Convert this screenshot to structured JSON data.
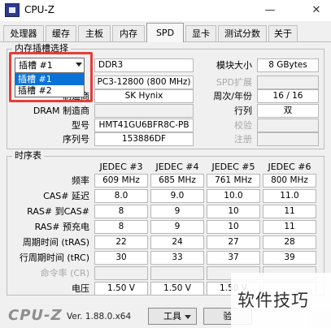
{
  "window": {
    "title": "CPU-Z",
    "minimize_glyph": "—",
    "close_glyph": "✕"
  },
  "tabs": [
    "处理器",
    "缓存",
    "主板",
    "内存",
    "SPD",
    "显卡",
    "测试分数",
    "关于"
  ],
  "slot": {
    "legend": "内存插槽选择",
    "selected": "插槽 #1",
    "options": [
      "插槽 #1",
      "插槽 #2"
    ],
    "type_value": "DDR3",
    "module_size_label": "模块大小",
    "module_size_value": "8 GBytes",
    "speed_value": "PC3-12800 (800 MHz)",
    "spd_ext_label": "SPD扩展",
    "maker_label": "制造商",
    "maker_value": "SK Hynix",
    "week_year_label": "周次/年份",
    "week_year_value": "16 / 16",
    "ranks_label": "行列",
    "ranks_value": "双",
    "dram_maker_label": "DRAM 制造商",
    "part_label": "型号",
    "part_value": "HMT41GU6BFR8C-PB",
    "verify_label": "校验",
    "serial_label": "序列号",
    "serial_value": "153886DF",
    "registered_label": "注册"
  },
  "timings": {
    "legend": "时序表",
    "headers": [
      "JEDEC #3",
      "JEDEC #4",
      "JEDEC #5",
      "JEDEC #6"
    ],
    "rows": [
      {
        "label": "频率",
        "values": [
          "609 MHz",
          "685 MHz",
          "761 MHz",
          "800 MHz"
        ],
        "dim": false
      },
      {
        "label": "CAS# 延迟",
        "values": [
          "8.0",
          "9.0",
          "10.0",
          "11.0"
        ],
        "dim": false
      },
      {
        "label": "RAS# 到CAS#",
        "values": [
          "8",
          "9",
          "10",
          "11"
        ],
        "dim": false
      },
      {
        "label": "RAS# 预充电",
        "values": [
          "8",
          "9",
          "10",
          "11"
        ],
        "dim": false
      },
      {
        "label": "周期时间 (tRAS)",
        "values": [
          "22",
          "24",
          "27",
          "28"
        ],
        "dim": false
      },
      {
        "label": "行周期时间 (tRC)",
        "values": [
          "30",
          "33",
          "37",
          "39"
        ],
        "dim": false
      },
      {
        "label": "命令率 (CR)",
        "values": [
          "",
          "",
          "",
          ""
        ],
        "dim": true
      },
      {
        "label": "电压",
        "values": [
          "1.50 V",
          "1.50 V",
          "1.50 V",
          ""
        ],
        "dim": false
      }
    ]
  },
  "footer": {
    "brand": "CPU-Z",
    "version": "Ver. 1.88.0.x64",
    "tools_label": "工具",
    "validate_label": "验"
  },
  "watermark": "软件技巧"
}
